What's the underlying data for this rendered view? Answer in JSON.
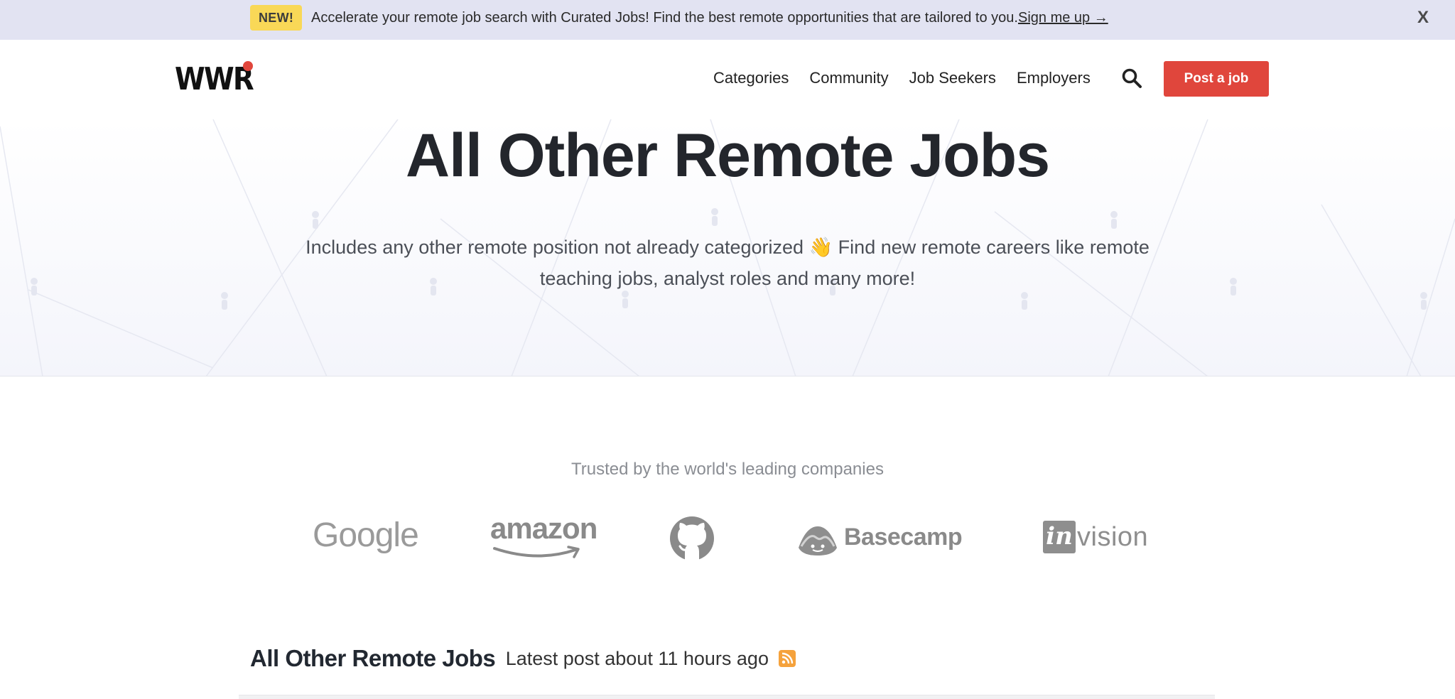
{
  "banner": {
    "badge": "NEW!",
    "text": "Accelerate your remote job search with Curated Jobs! Find the best remote opportunities that are tailored to you.",
    "link": "Sign me up →",
    "close": "X"
  },
  "nav": {
    "logo": "WWR",
    "links": [
      "Categories",
      "Community",
      "Job Seekers",
      "Employers"
    ],
    "post_button": "Post a job",
    "search_icon": "search-icon"
  },
  "hero": {
    "title": "All Other Remote Jobs",
    "description": "Includes any other remote position not already categorized 👋 Find new remote careers like remote teaching jobs, analyst roles and many more!"
  },
  "trusted": {
    "heading": "Trusted by the world's leading companies",
    "companies": {
      "google": "Google",
      "amazon": "amazon",
      "github_icon": "github-icon",
      "basecamp": "Basecamp",
      "invision_mark": "in",
      "invision": "vision"
    }
  },
  "section": {
    "title": "All Other Remote Jobs",
    "subtitle": "Latest post about 11 hours ago",
    "rss_icon": "rss-icon"
  },
  "colors": {
    "banner_bg": "#e2e3f2",
    "badge_bg": "#f9d857",
    "accent_red": "#e0463c",
    "rss_orange": "#f5a23c"
  }
}
